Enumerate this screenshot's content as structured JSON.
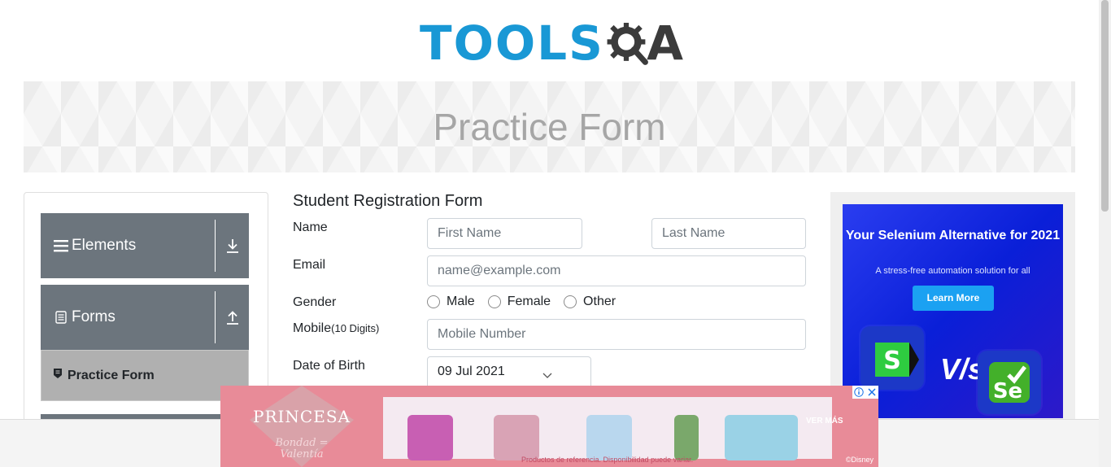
{
  "logo": {
    "brand": "TOOLS",
    "brand_suffix": "A",
    "gear_letter": "Q",
    "brand_color": "#1998d5",
    "gear_color": "#3b3b3b"
  },
  "banner": {
    "title": "Practice Form"
  },
  "sidebar": {
    "groups": [
      {
        "label": "Elements",
        "icon": "hamburger-icon",
        "toggle_icon": "download-arrow-icon"
      },
      {
        "label": "Forms",
        "icon": "document-icon",
        "toggle_icon": "upload-arrow-icon"
      }
    ],
    "active_item": {
      "label": "Practice Form",
      "icon": "form-badge-icon"
    }
  },
  "form": {
    "title": "Student Registration Form",
    "name": {
      "label": "Name",
      "first_placeholder": "First Name",
      "last_placeholder": "Last Name"
    },
    "email": {
      "label": "Email",
      "placeholder": "name@example.com"
    },
    "gender": {
      "label": "Gender",
      "options": [
        "Male",
        "Female",
        "Other"
      ]
    },
    "mobile": {
      "label": "Mobile",
      "hint": "(10 Digits)",
      "placeholder": "Mobile Number"
    },
    "dob": {
      "label": "Date of Birth",
      "value": "09 Jul 2021"
    }
  },
  "ad_right": {
    "headline": "Your Selenium Alternative for 2021",
    "subline": "A stress-free automation solution for all",
    "button": "Learn More",
    "versus": "V/s",
    "colors": {
      "background": "#0a1fd8",
      "button": "#1ba1f2"
    }
  },
  "ad_bottom": {
    "brand": "PRINCESA",
    "tagline": "Bondad = Valentía",
    "disclaimer": "Productos de referencia. Disponibilidad puede variar.",
    "cta": "VER MÁS",
    "copyright": "©Disney",
    "colors": {
      "background": "#e88b98"
    }
  }
}
